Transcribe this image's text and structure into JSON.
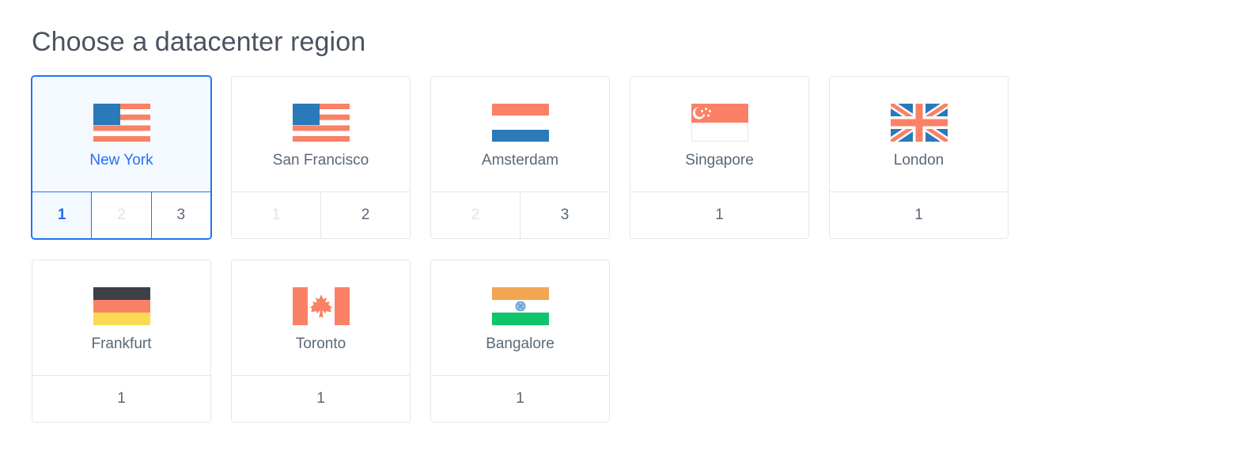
{
  "header": {
    "title": "Choose a datacenter region"
  },
  "colors": {
    "accent_blue": "#1f76f0",
    "selected_text_blue": "#2470f5",
    "selected_bg": "#f4f8ff",
    "label_gray": "#5a6876",
    "disabled_gray": "#dfe3e8",
    "border_gray": "#e3e6e8",
    "flag_salmon": "#fa8165",
    "flag_blue": "#2a7ab9",
    "flag_dark": "#3d4044",
    "flag_yellow": "#fada55",
    "flag_orange": "#f2a653",
    "flag_green": "#0fc469"
  },
  "regions": [
    {
      "name": "New York",
      "flag": "us-flag-icon",
      "selected": true,
      "slots": [
        {
          "label": "1",
          "state": "selected"
        },
        {
          "label": "2",
          "state": "disabled"
        },
        {
          "label": "3",
          "state": "available"
        }
      ]
    },
    {
      "name": "San Francisco",
      "flag": "us-flag-icon",
      "selected": false,
      "slots": [
        {
          "label": "1",
          "state": "disabled"
        },
        {
          "label": "2",
          "state": "available"
        }
      ]
    },
    {
      "name": "Amsterdam",
      "flag": "netherlands-flag-icon",
      "selected": false,
      "slots": [
        {
          "label": "2",
          "state": "disabled"
        },
        {
          "label": "3",
          "state": "available"
        }
      ]
    },
    {
      "name": "Singapore",
      "flag": "singapore-flag-icon",
      "selected": false,
      "slots": [
        {
          "label": "1",
          "state": "available"
        }
      ]
    },
    {
      "name": "London",
      "flag": "united-kingdom-flag-icon",
      "selected": false,
      "slots": [
        {
          "label": "1",
          "state": "available"
        }
      ]
    },
    {
      "name": "Frankfurt",
      "flag": "germany-flag-icon",
      "selected": false,
      "slots": [
        {
          "label": "1",
          "state": "available"
        }
      ]
    },
    {
      "name": "Toronto",
      "flag": "canada-flag-icon",
      "selected": false,
      "slots": [
        {
          "label": "1",
          "state": "available"
        }
      ]
    },
    {
      "name": "Bangalore",
      "flag": "india-flag-icon",
      "selected": false,
      "slots": [
        {
          "label": "1",
          "state": "available"
        }
      ]
    }
  ]
}
